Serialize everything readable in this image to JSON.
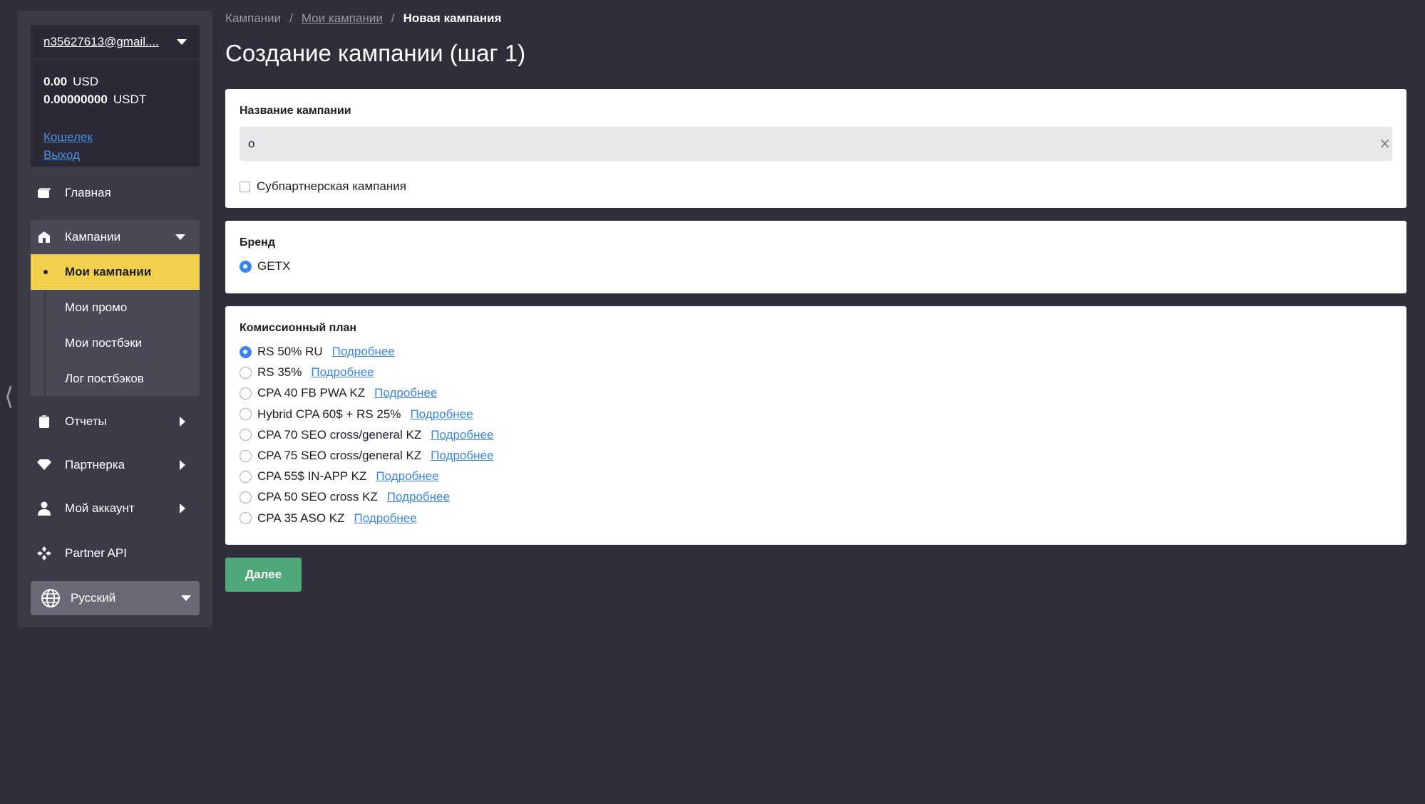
{
  "sidebar": {
    "account": {
      "email": "n35627613@gmail....",
      "balances": [
        {
          "amount": "0.00",
          "currency": "USD"
        },
        {
          "amount": "0.00000000",
          "currency": "USDT"
        }
      ],
      "wallet_link": "Кошелек",
      "logout_link": "Выход"
    },
    "nav": {
      "home": "Главная",
      "campaigns": "Кампании",
      "sub": [
        "Мои кампании",
        "Мои промо",
        "Мои постбэки",
        "Лог постбэков"
      ],
      "reports": "Отчеты",
      "partner": "Партнерка",
      "account": "Мой аккаунт",
      "api": "Partner API"
    },
    "language": "Русский",
    "active_color": "#f0d04c"
  },
  "breadcrumb": {
    "root": "Кампании",
    "sep": "/",
    "parent": "Мои кампании",
    "current": "Новая кампания"
  },
  "page_title": "Создание кампании (шаг 1)",
  "form": {
    "name_label": "Название кампании",
    "name_value": "о",
    "clear_icon": "×",
    "subpartner_label": "Субпартнерская кампания",
    "subpartner_checked": false,
    "brand_label": "Бренд",
    "brand_option": "GETX",
    "plan_label": "Комиссионный план",
    "plan_link": "Подробнее",
    "plans": [
      "RS 50% RU",
      "RS 35%",
      "CPA 40 FB PWA KZ",
      "Hybrid CPA 60$ + RS 25%",
      "CPA 70 SEO cross/general KZ",
      "CPA 75 SEO cross/general KZ",
      "CPA 55$ IN-APP KZ",
      "CPA 50 SEO cross KZ",
      "CPA 35 ASO KZ"
    ],
    "selected_plan": "RS 50% RU",
    "next_button": "Далее"
  },
  "colors": {
    "background": "#2f2e3a",
    "sidebar": "#3b3a47",
    "accent_blue": "#3a86e8",
    "button_green": "#4fa877"
  }
}
